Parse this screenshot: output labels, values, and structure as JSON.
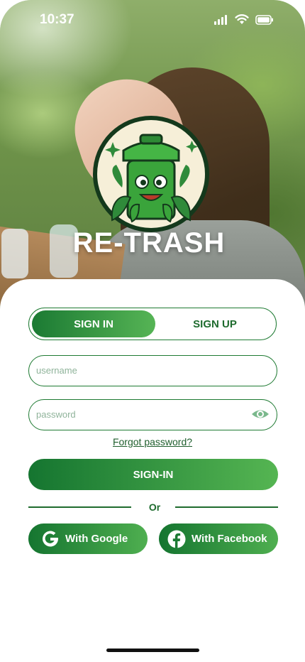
{
  "status": {
    "time": "10:37"
  },
  "brand": {
    "name": "RE-TRASH"
  },
  "auth_tabs": {
    "sign_in": "SIGN IN",
    "sign_up": "SIGN UP",
    "active": "sign_in"
  },
  "form": {
    "username_placeholder": "username",
    "password_placeholder": "password",
    "forgot_label": "Forgot password?",
    "submit_label": "SIGN-IN",
    "divider_label": "Or"
  },
  "social": {
    "google_label": "With Google",
    "facebook_label": "With Facebook"
  },
  "colors": {
    "primary": "#1b7a33",
    "primary_light": "#56b455",
    "text_green": "#1e6b2e"
  },
  "icons": [
    "signal-icon",
    "wifi-icon",
    "battery-icon",
    "trash-mascot-logo",
    "eye-icon",
    "google-icon",
    "facebook-icon"
  ]
}
